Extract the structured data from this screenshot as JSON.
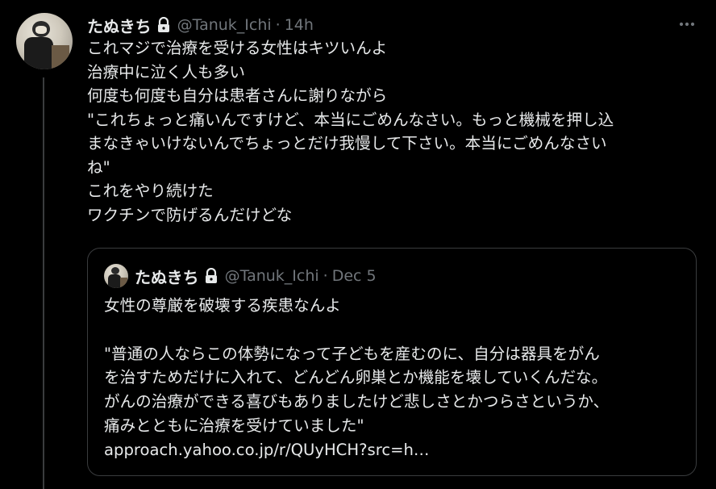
{
  "tweet": {
    "display_name": "たぬきち",
    "handle": "@Tanuk_Ichi",
    "separator": "·",
    "time": "14h",
    "lines": [
      "これマジで治療を受ける女性はキツいんよ",
      "治療中に泣く人も多い",
      "何度も何度も自分は患者さんに謝りながら",
      "\"これちょっと痛いんですけど、本当にごめんなさい。もっと機械を押し込",
      "まなきゃいけないんでちょっとだけ我慢して下さい。本当にごめんなさい",
      "ね\"",
      "これをやり続けた",
      "ワクチンで防げるんだけどな"
    ]
  },
  "quote": {
    "display_name": "たぬきち",
    "handle": "@Tanuk_Ichi",
    "separator": "·",
    "time": "Dec 5",
    "lines": [
      "女性の尊厳を破壊する疾患なんよ",
      "",
      "\"普通の人ならこの体勢になって子どもを産むのに、自分は器具をがん",
      "を治すためだけに入れて、どんどん卵巣とか機能を壊していくんだな。",
      "がんの治療ができる喜びもありましたけど悲しさとかつらさというか、",
      "痛みとともに治療を受けていました\"",
      "approach.yahoo.co.jp/r/QUyHCH?src=h…"
    ]
  },
  "icons": {
    "lock": "lock-icon",
    "more": "more-horizontal-icon"
  },
  "colors": {
    "background": "#000000",
    "text_primary": "#e7e9ea",
    "text_secondary": "#71767b",
    "border": "#3a3c3e"
  }
}
